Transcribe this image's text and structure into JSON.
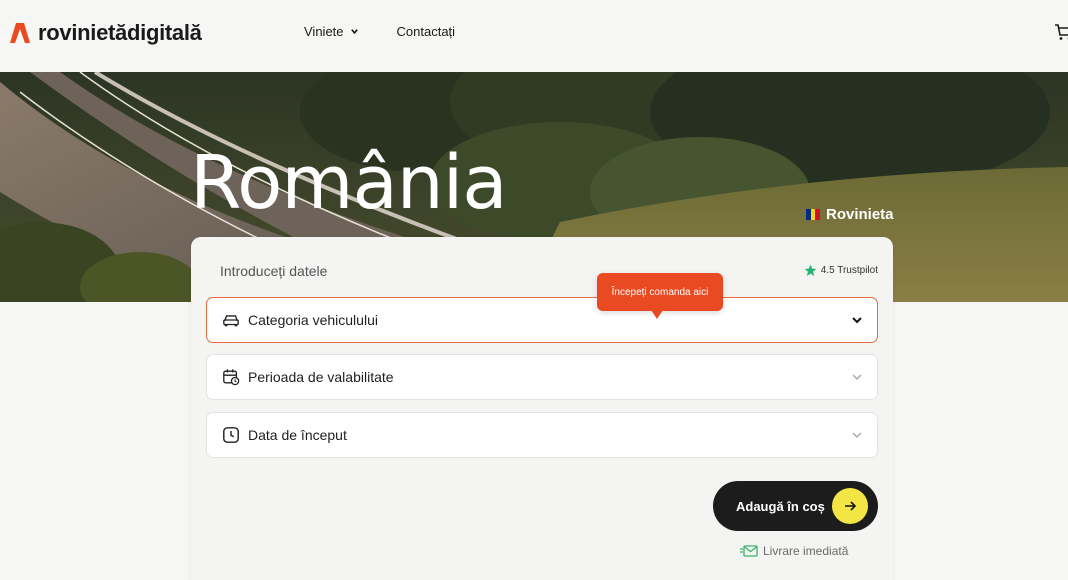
{
  "header": {
    "logo_text": "rovinietădigitală",
    "nav": [
      {
        "label": "Viniete",
        "has_dropdown": true
      },
      {
        "label": "Contactați",
        "has_dropdown": false
      }
    ],
    "cart_icon": "cart-icon"
  },
  "hero": {
    "title": "România",
    "badge_label": "Rovinieta",
    "badge_icon": "romania-flag-icon"
  },
  "form": {
    "title": "Introduceți datele",
    "trustpilot": "4.5 Trustpilot",
    "tooltip": "Începeți comanda aici",
    "fields": [
      {
        "label": "Categoria vehiculului",
        "icon": "car-icon",
        "active": true
      },
      {
        "label": "Perioada de valabilitate",
        "icon": "calendar-icon",
        "active": false
      },
      {
        "label": "Data de început",
        "icon": "clock-icon",
        "active": false
      }
    ],
    "cta_label": "Adaugă în coș",
    "delivery_label": "Livrare imediată"
  },
  "colors": {
    "accent": "#ea4a22",
    "cta_bg": "#1c1c1c",
    "cta_arrow_bg": "#f3e544",
    "active_border": "#ea6a3c",
    "trust_star": "#22b573",
    "delivery_green": "#3bb56b"
  }
}
